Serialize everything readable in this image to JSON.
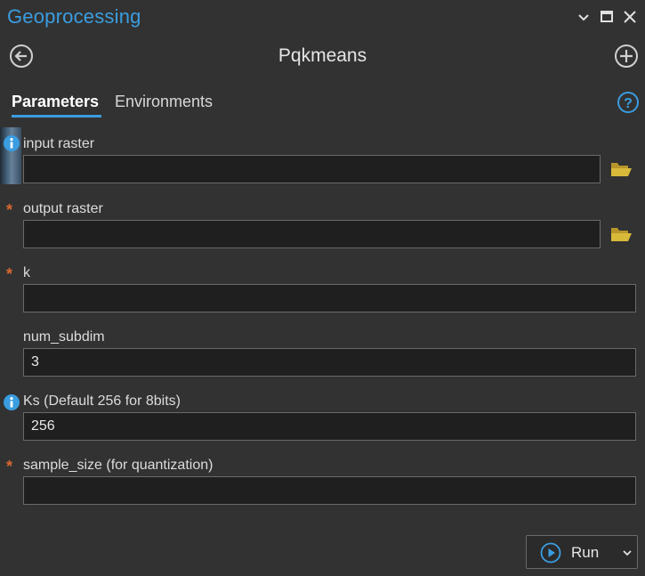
{
  "pane": {
    "title": "Geoprocessing"
  },
  "window_controls": {
    "menu_icon": "chevron-down-icon",
    "maximize_icon": "maximize-icon",
    "close_icon": "close-icon"
  },
  "tool": {
    "name": "Pqkmeans",
    "back_icon": "back-arrow-icon",
    "add_icon": "plus-circle-icon"
  },
  "tabs": [
    {
      "label": "Parameters",
      "active": true
    },
    {
      "label": "Environments",
      "active": false
    }
  ],
  "help_icon": "help-icon",
  "parameters": [
    {
      "label": "input raster",
      "marker": "info",
      "value": "",
      "browse": true
    },
    {
      "label": "output raster",
      "marker": "required",
      "value": "",
      "browse": true
    },
    {
      "label": "k",
      "marker": "required",
      "value": "",
      "browse": false
    },
    {
      "label": "num_subdim",
      "marker": "none",
      "value": "3",
      "browse": false
    },
    {
      "label": "Ks (Default 256 for 8bits)",
      "marker": "info",
      "value": "256",
      "browse": false
    },
    {
      "label": "sample_size (for quantization)",
      "marker": "required",
      "value": "",
      "browse": false
    }
  ],
  "required_marker": "*",
  "run_button": {
    "label": "Run",
    "icon": "play-icon",
    "dropdown_icon": "chevron-down-icon"
  },
  "colors": {
    "accent": "#3a9de0",
    "background": "#323232",
    "field_background": "#1f1f1f",
    "required_marker": "#d8692f",
    "folder_icon": "#d9b93a"
  }
}
